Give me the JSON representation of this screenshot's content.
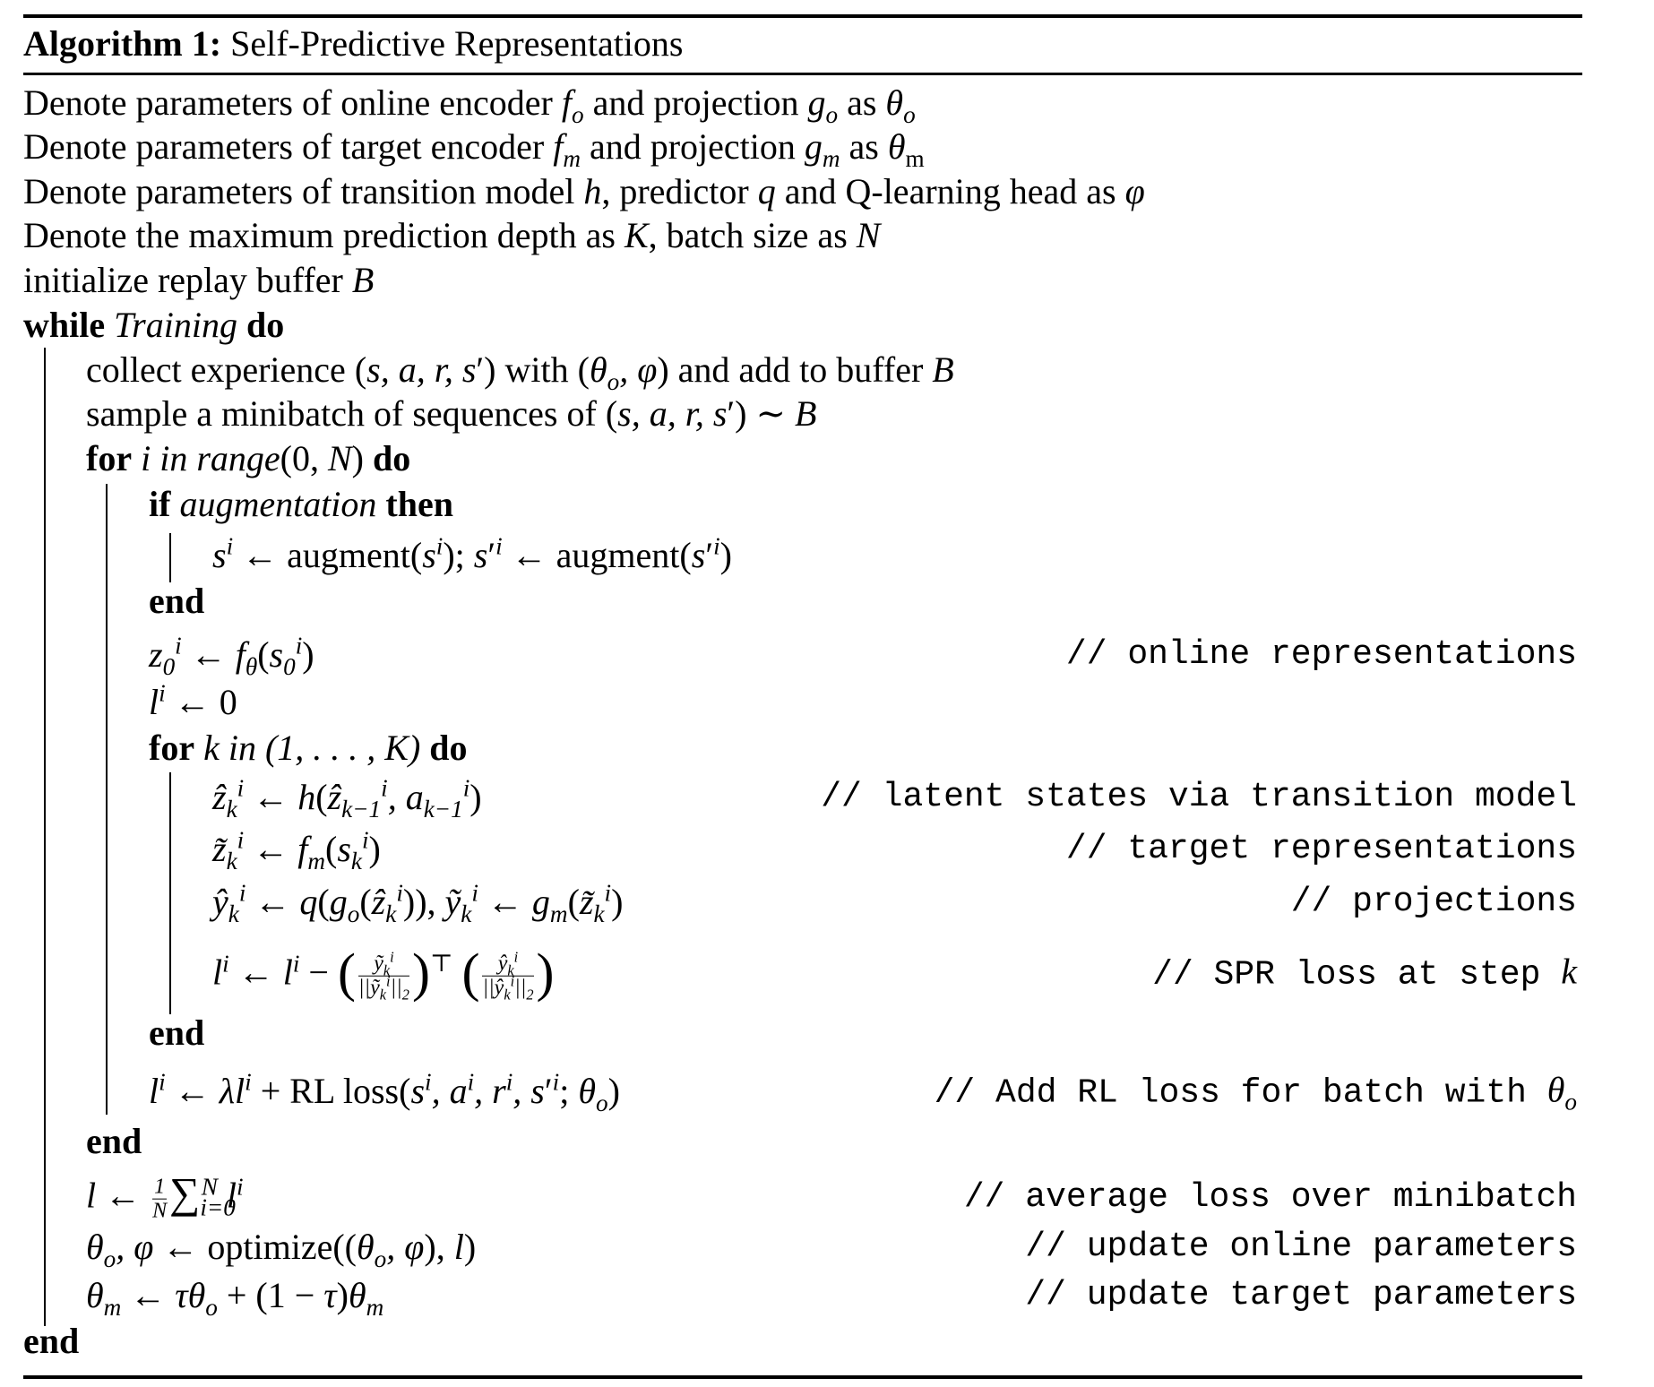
{
  "algorithm": {
    "label": "Algorithm 1:",
    "title": "Self-Predictive Representations"
  },
  "lines": [
    {
      "text": "Denote parameters of online encoder f_o and projection g_o as θ_o"
    },
    {
      "text": "Denote parameters of target encoder f_m and projection g_m as θ_m"
    },
    {
      "text": "Denote parameters of transition model h, predictor q and Q-learning head as φ"
    },
    {
      "text": "Denote the maximum prediction depth as K, batch size as N"
    },
    {
      "text": "initialize replay buffer B"
    },
    {
      "kw1": "while",
      "cond": "Training",
      "kw2": "do"
    },
    {
      "text": "collect experience (s, a, r, s′) with (θ_o, φ) and add to buffer B"
    },
    {
      "text": "sample a minibatch of sequences of (s, a, r, s′) ∼ B"
    },
    {
      "kw1": "for",
      "cond": "i in range(0, N)",
      "kw2": "do"
    },
    {
      "kw1": "if",
      "cond": "augmentation",
      "kw2": "then"
    },
    {
      "text": "s^i ← augment(s^i); s′^i ← augment(s′^i)"
    },
    {
      "kw": "end"
    },
    {
      "text": "z_0^i ← f_θ(s_0^i)",
      "comment": "// online representations"
    },
    {
      "text": "l^i ← 0"
    },
    {
      "kw1": "for",
      "cond": "k in (1, . . . , K)",
      "kw2": "do"
    },
    {
      "text": "ẑ_k^i ← h(ẑ_{k−1}^i, a_{k−1}^i)",
      "comment": "// latent states via transition model"
    },
    {
      "text": "z̃_k^i ← f_m(s_k^i)",
      "comment": "// target representations"
    },
    {
      "text": "ŷ_k^i ← q(g_o(ẑ_k^i)), ỹ_k^i ← g_m(z̃_k^i)",
      "comment": "// projections"
    },
    {
      "text": "l^i ← l^i − (ỹ_k^i / ||ỹ_k^i||_2)^T (ŷ_k^i / ||ŷ_k^i||_2)",
      "comment": "// SPR loss at step",
      "comment_var": "k"
    },
    {
      "kw": "end"
    },
    {
      "text": "l^i ← λl^i + RL loss(s^i, a^i, r^i, s′^i; θ_o)",
      "comment": "// Add RL loss for batch with",
      "comment_var": "θ_o"
    },
    {
      "kw": "end"
    },
    {
      "text": "l ← 1/N Σ_{i=0}^N l^i",
      "comment": "// average loss over minibatch"
    },
    {
      "text": "θ_o, φ ← optimize((θ_o, φ), l)",
      "comment": "// update online parameters"
    },
    {
      "text": "θ_m ← τθ_o + (1 − τ)θ_m",
      "comment": "// update target parameters"
    },
    {
      "kw": "end"
    }
  ],
  "words": {
    "denote_params_of": "Denote parameters of",
    "online_encoder": "online encoder",
    "target_encoder": "target encoder",
    "and_projection": "and projection",
    "as": "as",
    "transition_model": "transition model",
    "predictor": "predictor",
    "and_q_head": "and Q-learning head as",
    "denote_max_depth": "Denote the maximum prediction depth as",
    "batch_size_as": "batch size as",
    "init_buffer": "initialize replay buffer",
    "collect": "collect experience",
    "with": "with",
    "add_to_buffer": "and add to buffer",
    "sample": "sample a minibatch of sequences of",
    "augment": "augment",
    "rl_loss": "RL loss",
    "optimize": "optimize",
    "while": "while",
    "training": "Training",
    "do": "do",
    "for": "for",
    "if": "if",
    "augmentation": "augmentation",
    "then": "then",
    "end": "end",
    "in_range": "in range",
    "k_range": "in (1, . . . , K)"
  },
  "comments": {
    "online": "// online representations",
    "latent": "// latent states via transition model",
    "target": "// target representations",
    "proj": "// projections",
    "spr": "// SPR loss at step",
    "rl": "// Add RL loss for batch with",
    "avg": "// average loss over minibatch",
    "upd_online": "// update online parameters",
    "upd_target": "// update target parameters"
  }
}
